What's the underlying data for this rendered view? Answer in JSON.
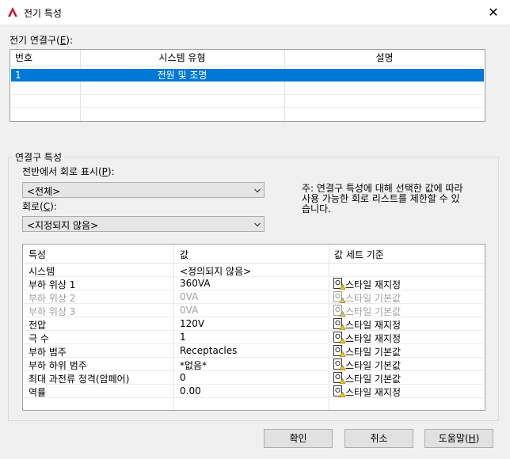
{
  "window": {
    "title": "전기 특성",
    "close_glyph": "✕",
    "logo_letter": "A",
    "logo_color": "#c8102e"
  },
  "connectors": {
    "label": "전기 연결구(",
    "label_key": "E",
    "label_suffix": "):",
    "columns": [
      "번호",
      "시스템 유형",
      "설명"
    ],
    "rows": [
      {
        "number": "1",
        "system_type": "전원 및 조명",
        "description": ""
      }
    ],
    "selected_color": "#0078d7"
  },
  "connector_props": {
    "group_title": "연결구 특성",
    "panel_label": "전반에서 회로 표시(",
    "panel_key": "P",
    "panel_suffix": "):",
    "panel_value": "<전체>",
    "circuit_label": "회로(",
    "circuit_key": "C",
    "circuit_suffix": "):",
    "circuit_value": "<지정되지 않음>",
    "note": "주: 연결구 특성에 대해 선택한 값에 따라 사용 가능한 회로 리스트를 제한할 수 있습니다."
  },
  "properties": {
    "columns": [
      "특성",
      "값",
      "값 세트 기준"
    ],
    "rows": [
      {
        "name": "시스템",
        "value": "<정의되지 않음>",
        "basis": "",
        "disabled": false
      },
      {
        "name": "부하 위상 1",
        "value": "360VA",
        "basis": "스타일 재지정",
        "disabled": false
      },
      {
        "name": "부하 위상 2",
        "value": "0VA",
        "basis": "스타일 기본값",
        "disabled": true
      },
      {
        "name": "부하 위상 3",
        "value": "0VA",
        "basis": "스타일 기본값",
        "disabled": true
      },
      {
        "name": "전압",
        "value": "120V",
        "basis": "스타일 재지정",
        "disabled": false
      },
      {
        "name": "극 수",
        "value": "1",
        "basis": "스타일 재지정",
        "disabled": false
      },
      {
        "name": "부하 범주",
        "value": "Receptacles",
        "basis": "스타일 기본값",
        "disabled": false
      },
      {
        "name": "부하 하위 범주",
        "value": "*없음*",
        "basis": "스타일 기본값",
        "disabled": false
      },
      {
        "name": "최대 과전류 정격(암페어)",
        "value": "0",
        "basis": "스타일 기본값",
        "disabled": false
      },
      {
        "name": "역률",
        "value": "0.00",
        "basis": "스타일 재지정",
        "disabled": false
      }
    ],
    "basis_icon": "style-source-icon"
  },
  "buttons": {
    "ok": "확인",
    "cancel": "취소",
    "help": "도움말(",
    "help_key": "H",
    "help_suffix": ")"
  }
}
